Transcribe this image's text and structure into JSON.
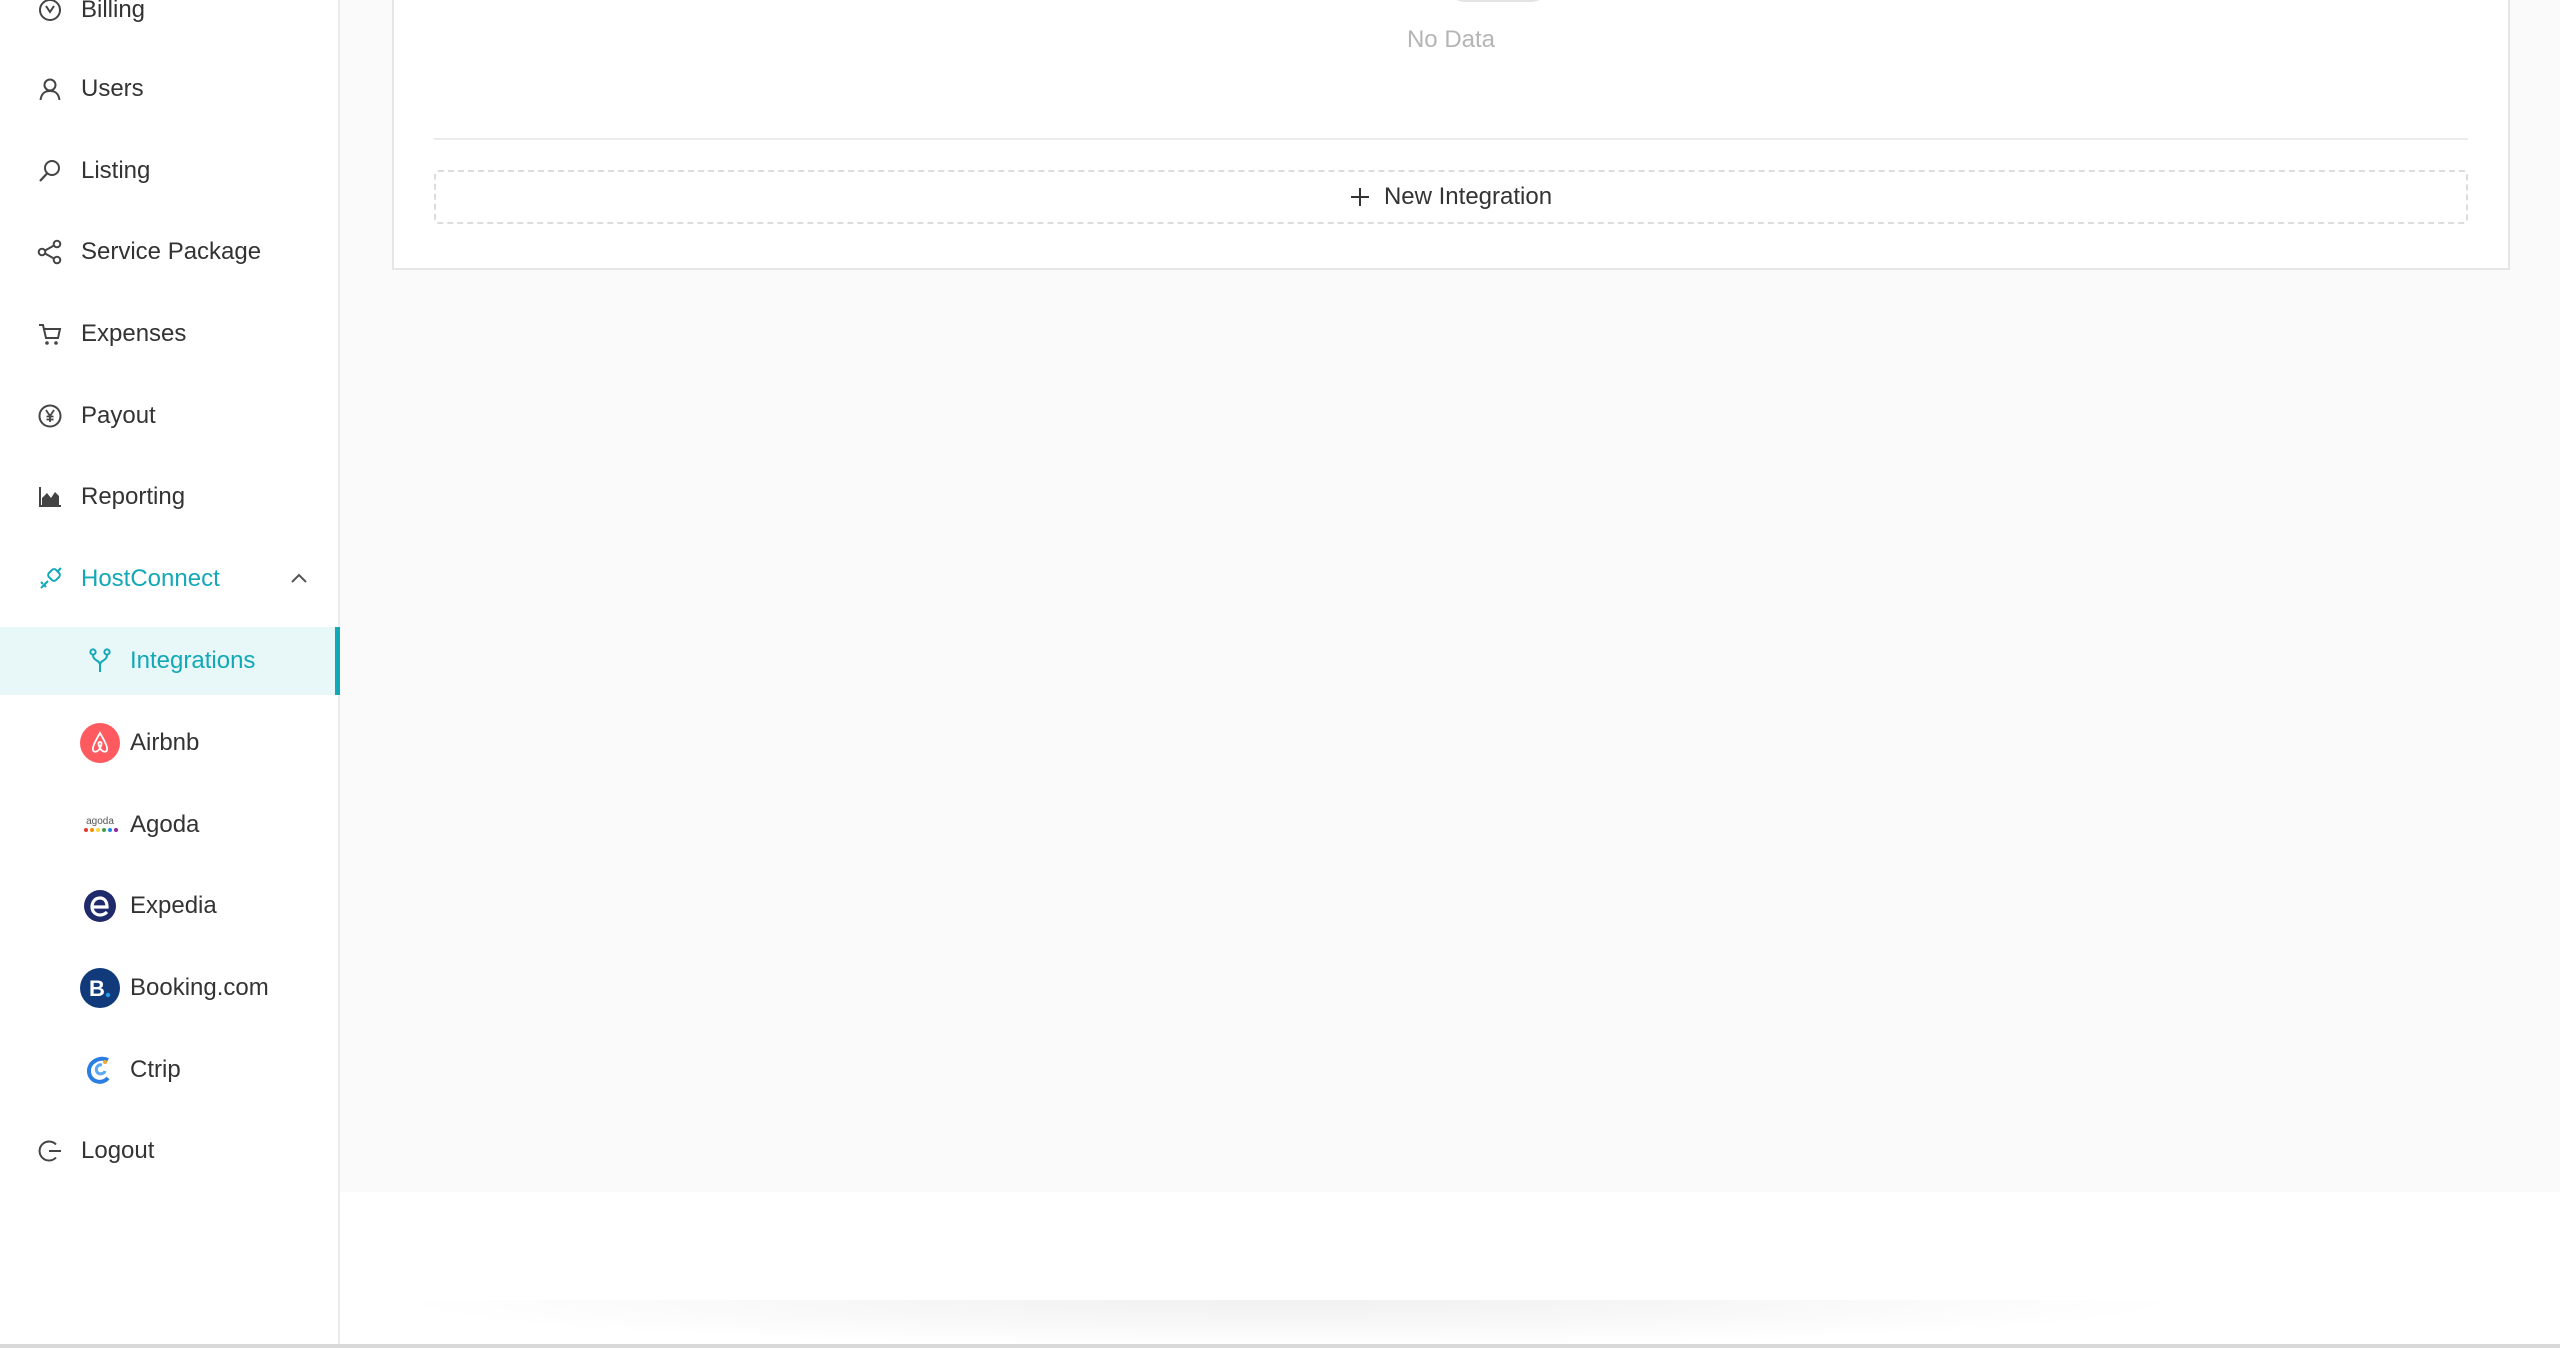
{
  "sidebar": {
    "items": [
      {
        "label": "Billing",
        "icon": "billing-icon"
      },
      {
        "label": "Users",
        "icon": "user-icon"
      },
      {
        "label": "Listing",
        "icon": "search-icon"
      },
      {
        "label": "Service Package",
        "icon": "share-icon"
      },
      {
        "label": "Expenses",
        "icon": "cart-icon"
      },
      {
        "label": "Payout",
        "icon": "yen-circle-icon"
      },
      {
        "label": "Reporting",
        "icon": "area-chart-icon"
      },
      {
        "label": "HostConnect",
        "icon": "link-icon",
        "expanded": true
      },
      {
        "label": "Logout",
        "icon": "logout-icon"
      }
    ],
    "hostconnect_children": [
      {
        "label": "Integrations",
        "icon": "fork-icon",
        "selected": true
      },
      {
        "label": "Airbnb",
        "icon": "airbnb-logo-icon"
      },
      {
        "label": "Agoda",
        "icon": "agoda-logo-icon"
      },
      {
        "label": "Expedia",
        "icon": "expedia-logo-icon"
      },
      {
        "label": "Booking.com",
        "icon": "booking-logo-icon"
      },
      {
        "label": "Ctrip",
        "icon": "ctrip-logo-icon"
      }
    ]
  },
  "main": {
    "empty_text": "No Data",
    "new_integration_label": "New Integration"
  },
  "colors": {
    "accent": "#13a8b8",
    "selected_bg": "#e8f8f9",
    "airbnb": "#ff5a5f",
    "expedia": "#1f2a6b",
    "booking": "#113a7a"
  }
}
